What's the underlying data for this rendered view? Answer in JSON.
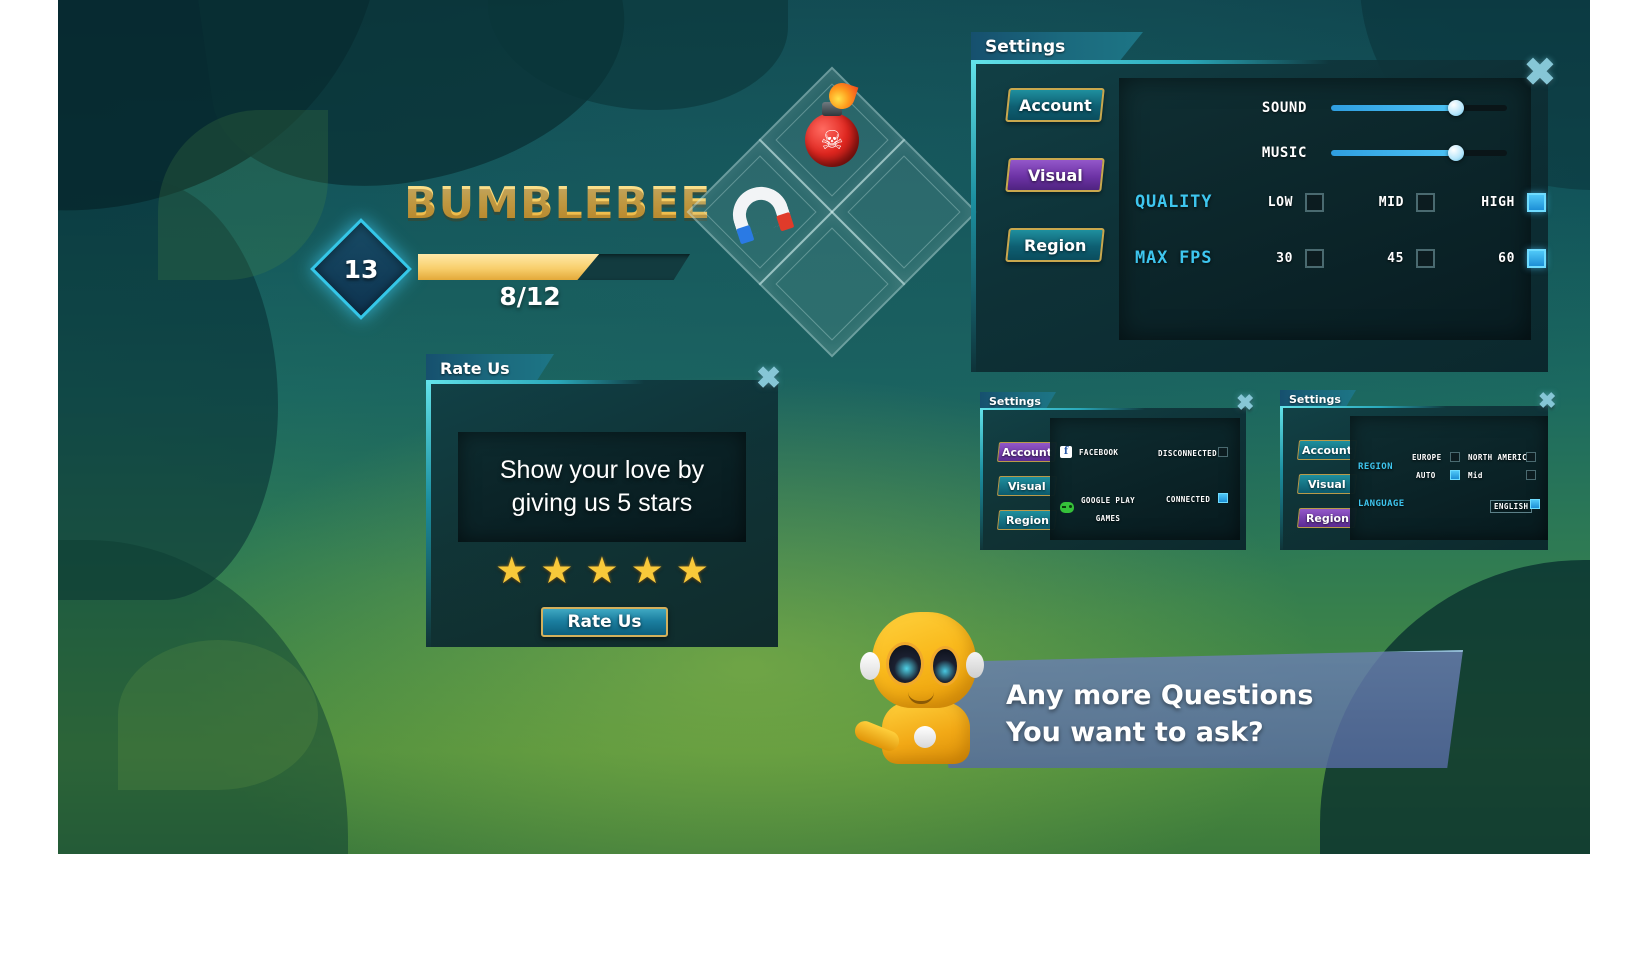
{
  "hero": {
    "name": "BUMBLEBEE",
    "level": "13",
    "xp_text": "8/12",
    "xp_percent": 66.6
  },
  "powerups": [
    {
      "name": "bomb",
      "slot": "top",
      "filled": true
    },
    {
      "name": "magnet",
      "slot": "left",
      "filled": true
    },
    {
      "name": "empty",
      "slot": "right",
      "filled": false
    },
    {
      "name": "empty",
      "slot": "bottom",
      "filled": false
    }
  ],
  "settings_main": {
    "title": "Settings",
    "close_icon": "close-icon",
    "nav": [
      {
        "label": "Account",
        "color": "teal",
        "active": false
      },
      {
        "label": "Visual",
        "color": "purple",
        "active": true
      },
      {
        "label": "Region",
        "color": "teal",
        "active": false
      }
    ],
    "sound": {
      "label": "SOUND",
      "value": 71
    },
    "music": {
      "label": "MUSIC",
      "value": 71
    },
    "quality": {
      "label": "QUALITY",
      "options": [
        {
          "label": "LOW",
          "checked": false
        },
        {
          "label": "MID",
          "checked": false
        },
        {
          "label": "HIGH",
          "checked": true
        }
      ]
    },
    "max_fps": {
      "label": "MAX FPS",
      "options": [
        {
          "label": "30",
          "checked": false
        },
        {
          "label": "45",
          "checked": false
        },
        {
          "label": "60",
          "checked": true
        }
      ]
    }
  },
  "rate_us": {
    "title": "Rate Us",
    "message_line1": "Show your love by",
    "message_line2": "giving us 5 stars",
    "stars": 5,
    "star_glyph": "★",
    "button_label": "Rate Us",
    "close_icon": "close-icon"
  },
  "settings_account": {
    "title": "Settings",
    "close_icon": "close-icon",
    "nav": [
      {
        "label": "Account",
        "color": "purple",
        "active": true
      },
      {
        "label": "Visual",
        "color": "teal",
        "active": false
      },
      {
        "label": "Region",
        "color": "teal",
        "active": false
      }
    ],
    "rows": [
      {
        "icon": "facebook-icon",
        "label": "FACEBOOK",
        "status": "DISCONNECTED",
        "checked": false
      },
      {
        "icon": "google-play-games-icon",
        "label_line1": "GOOGLE PLAY",
        "label_line2": "GAMES",
        "status": "CONNECTED",
        "checked": true
      }
    ]
  },
  "settings_region": {
    "title": "Settings",
    "close_icon": "close-icon",
    "nav": [
      {
        "label": "Account",
        "color": "teal",
        "active": false
      },
      {
        "label": "Visual",
        "color": "teal",
        "active": false
      },
      {
        "label": "Region",
        "color": "purple",
        "active": true
      }
    ],
    "region": {
      "label": "REGION",
      "options": [
        {
          "label": "EUROPE",
          "checked": false
        },
        {
          "label": "NORTH AMERICA",
          "checked": false
        },
        {
          "label": "AUTO",
          "checked": true
        },
        {
          "label": "Mid",
          "checked": false
        }
      ]
    },
    "language": {
      "label": "LANGUAGE",
      "value": "ENGLISH",
      "checked": true
    }
  },
  "assistant": {
    "character": "yellow-robot",
    "line1": "Any more Questions",
    "line2": "You want to ask?"
  },
  "colors": {
    "accent_cyan": "#3ec6ef",
    "gold": "#f6cf62",
    "purple": "#9357c9",
    "teal": "#1f8f9e",
    "star": "#f8c93a"
  }
}
